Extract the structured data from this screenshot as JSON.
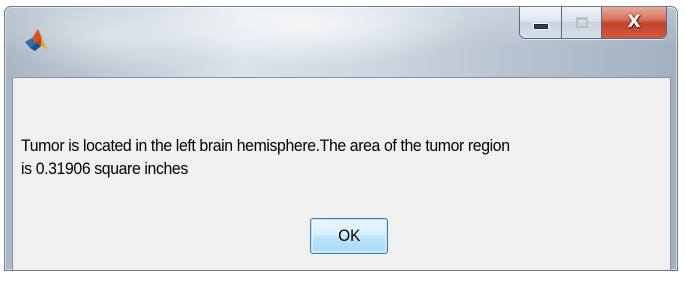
{
  "window": {
    "title": "",
    "icon": "matlab-logo-icon",
    "caption_buttons": {
      "minimize_icon": "minimize-icon",
      "maximize_icon": "maximize-icon",
      "close_label": "X"
    }
  },
  "dialog": {
    "message_line1": "Tumor is located in the left brain hemisphere.The area of the tumor region",
    "message_line2": "is 0.31906 square inches",
    "ok_label": "OK"
  },
  "colors": {
    "client_background": "#f0f0f0",
    "close_button": "#c3432b",
    "ok_button_border": "#3c7fb1"
  }
}
